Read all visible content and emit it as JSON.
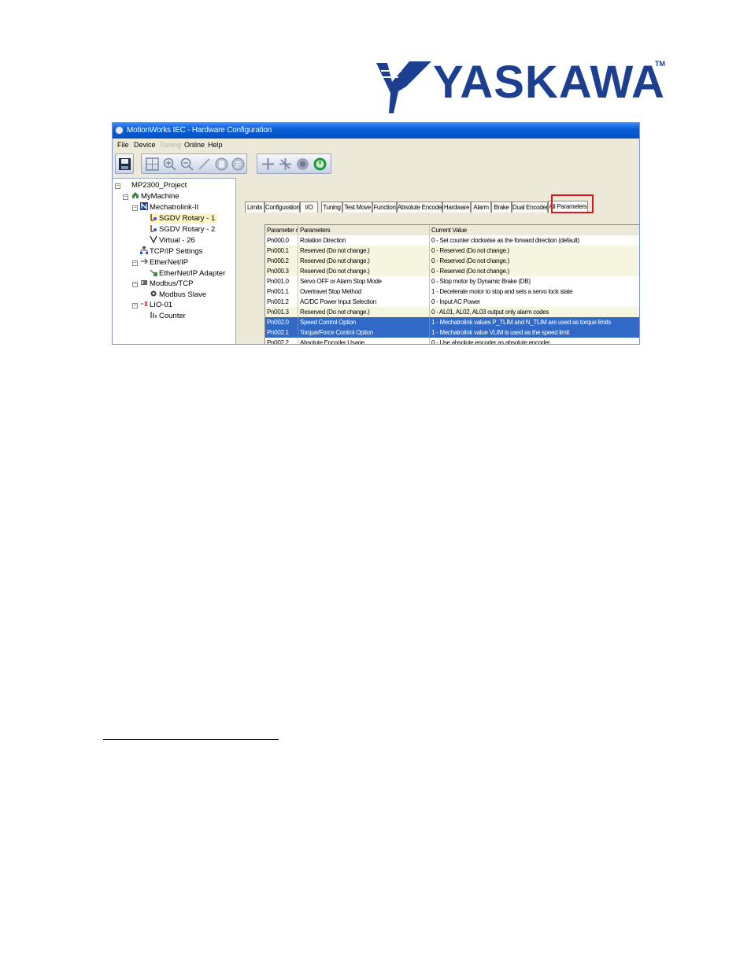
{
  "logo": {
    "text": "YASKAWA",
    "tm": "TM"
  },
  "window": {
    "title": "MotionWorks IEC - Hardware Configuration",
    "menu": [
      "File",
      "Device",
      "Tuning",
      "Online",
      "Help"
    ],
    "menu_disabled_index": 2
  },
  "tree": {
    "items": [
      {
        "label": "MP2300_Project",
        "icon": "project-icon"
      },
      {
        "label": "MyMachine",
        "icon": "machine-icon"
      },
      {
        "label": "Mechatrolink-II",
        "icon": "mechatrolink-icon"
      },
      {
        "label": "SGDV Rotary - 1",
        "icon": "servo-axis-icon",
        "selected": true
      },
      {
        "label": "SGDV Rotary - 2",
        "icon": "servo-axis-icon"
      },
      {
        "label": "Virtual - 26",
        "icon": "virtual-axis-icon"
      },
      {
        "label": "TCP/IP Settings",
        "icon": "network-icon"
      },
      {
        "label": "EtherNet/IP",
        "icon": "ethernet-icon"
      },
      {
        "label": "EtherNet/IP Adapter",
        "icon": "adapter-icon"
      },
      {
        "label": "Modbus/TCP",
        "icon": "modbus-icon"
      },
      {
        "label": "Modbus Slave",
        "icon": "gear-icon"
      },
      {
        "label": "LIO-01",
        "icon": "io-module-icon"
      },
      {
        "label": "Counter",
        "icon": "counter-icon"
      }
    ]
  },
  "tabs": [
    "Limits",
    "Configuration",
    "I/O",
    "Tuning",
    "Test Move",
    "Function",
    "Absolute Encoder",
    "Hardware",
    "Alarm",
    "Brake",
    "Dual Encoder",
    "All Parameters"
  ],
  "active_tab": "All Parameters",
  "table": {
    "headers": [
      "Parameter #",
      "Parameters",
      "Current Value"
    ],
    "rows": [
      [
        "Pn000.0",
        "Rotation Direction",
        "0 - Set counter clockwise as the forward direction (default)"
      ],
      [
        "Pn000.1",
        "Reserved (Do not change.)",
        "0 - Reserved (Do not change.)"
      ],
      [
        "Pn000.2",
        "Reserved (Do not change.)",
        "0 - Reserved (Do not change.)"
      ],
      [
        "Pn000.3",
        "Reserved (Do not change.)",
        "0 - Reserved (Do not change.)"
      ],
      [
        "Pn001.0",
        "Servo OFF or Alarm Stop Mode",
        "0 - Stop motor by Dynamic Brake (DB)"
      ],
      [
        "Pn001.1",
        "Overtravel Stop Method",
        "1 - Decelerate motor to stop and sets a servo lock state"
      ],
      [
        "Pn001.2",
        "AC/DC Power Input Selection",
        "0 - Input AC Power"
      ],
      [
        "Pn001.3",
        "Reserved (Do not change.)",
        "0 - AL01, AL02, AL03 output only alarm codes"
      ],
      [
        "Pn002.0",
        "Speed Control Option",
        "1 - Mechatrolink values P_TLIM and N_TLIM are used as torque limits"
      ],
      [
        "Pn002.1",
        "Torque/Force Control Option",
        "1 - Mechatrolink value VLIM is used as the speed limit"
      ],
      [
        "Pn002.2",
        "Absolute Encoder Usage",
        "0 - Use absolute encoder as absolute encoder"
      ]
    ],
    "highlighted_rows": [
      8,
      9
    ]
  },
  "colors": {
    "brand": "#1c3f8f",
    "selection": "#3169c6",
    "highlight_box": "#e0141c"
  }
}
